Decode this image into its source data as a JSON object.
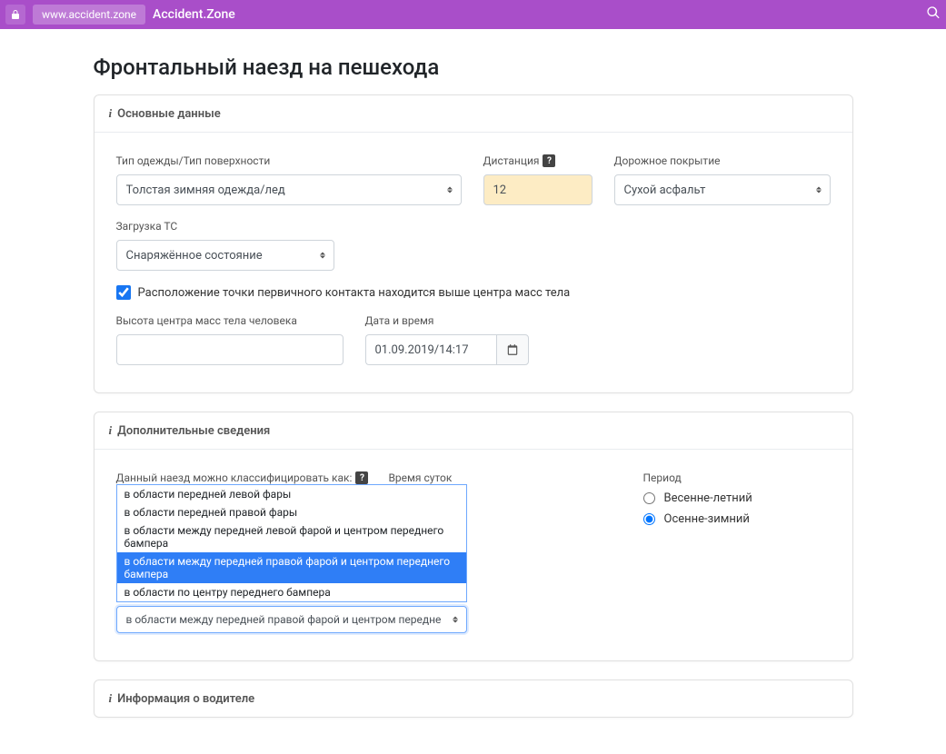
{
  "urlbar": {
    "host": "www.accident.zone",
    "app_title": "Accident.Zone"
  },
  "page": {
    "title": "Фронтальный наезд на пешехода"
  },
  "card_basic": {
    "header": "Основные данные",
    "clothing_label": "Тип одежды/Тип поверхности",
    "clothing_value": "Толстая зимняя одежда/лед",
    "distance_label": "Дистанция",
    "distance_value": "12",
    "road_label": "Дорожное покрытие",
    "road_value": "Сухой асфальт",
    "load_label": "Загрузка ТС",
    "load_value": "Снаряжённое состояние",
    "contact_checkbox_label": "Расположение точки первичного контакта находится выше центра масс тела",
    "contact_checked": true,
    "mass_height_label": "Высота центра масс тела человека",
    "mass_height_value": "",
    "datetime_label": "Дата и время",
    "datetime_value": "01.09.2019/14:17"
  },
  "card_additional": {
    "header": "Дополнительные сведения",
    "classify_label": "Данный наезд можно классифицировать как:",
    "time_label": "Время суток",
    "options": [
      "в области передней левой фары",
      "в области передней правой фары",
      "в области между передней левой фарой и центром переднего бампера",
      "в области между передней правой фарой и центром переднего бампера",
      "в области по центру переднего бампера"
    ],
    "selected_option": "в области между передней правой фарой и центром переднего бампе",
    "period_label": "Период",
    "period_options": [
      "Весенне-летний",
      "Осенне-зимний"
    ],
    "period_selected": 1
  },
  "card_driver": {
    "header": "Информация о водителе"
  }
}
